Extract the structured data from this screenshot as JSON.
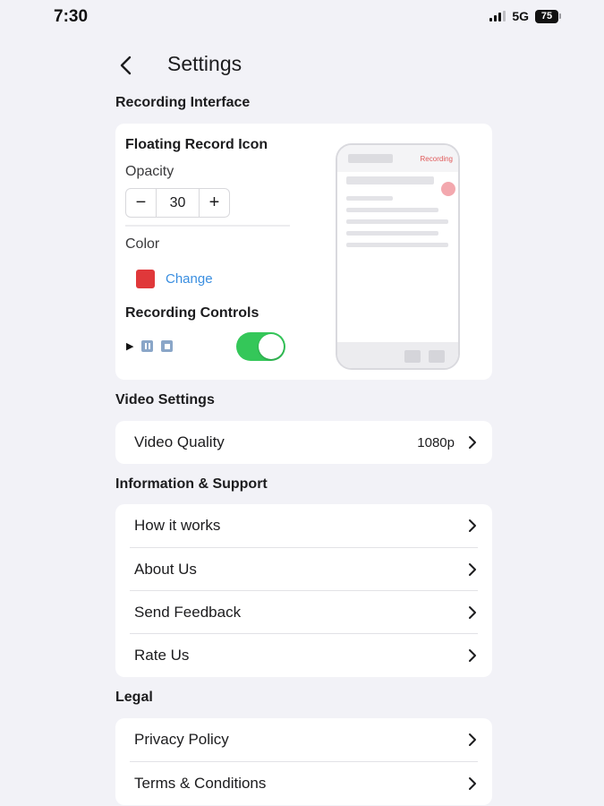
{
  "status_bar": {
    "time": "7:30",
    "network": "5G",
    "battery": "75"
  },
  "header": {
    "title": "Settings"
  },
  "recording_interface": {
    "section_title": "Recording Interface",
    "floating_icon_title": "Floating Record Icon",
    "opacity_label": "Opacity",
    "opacity_minus": "−",
    "opacity_value": "30",
    "opacity_plus": "+",
    "color_label": "Color",
    "color_value": "#e0383a",
    "change_label": "Change",
    "controls_title": "Recording Controls",
    "toggle_on": true,
    "preview_recording_label": "Recording"
  },
  "video_settings": {
    "section_title": "Video Settings",
    "video_quality_label": "Video Quality",
    "video_quality_value": "1080p"
  },
  "info_support": {
    "section_title": "Information & Support",
    "items": [
      {
        "label": "How it works"
      },
      {
        "label": "About Us"
      },
      {
        "label": "Send Feedback"
      },
      {
        "label": "Rate Us"
      }
    ]
  },
  "legal": {
    "section_title": "Legal",
    "items": [
      {
        "label": "Privacy Policy"
      },
      {
        "label": "Terms & Conditions"
      }
    ]
  },
  "colors": {
    "accent": "#3a8ee0",
    "toggle": "#34c759",
    "record": "#e0383a"
  }
}
